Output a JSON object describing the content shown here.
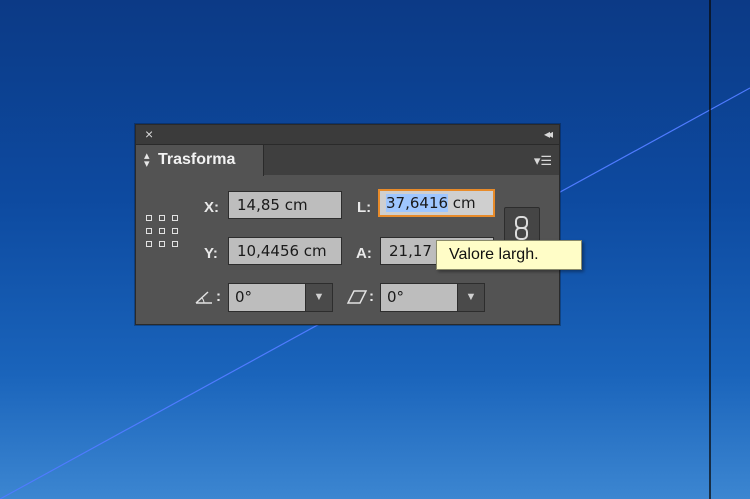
{
  "panel": {
    "close_glyph": "×",
    "collapse_glyph": "◂◂",
    "tab_title": "Trasforma",
    "menu_icon": "panel-menu-icon",
    "fields": {
      "x_label": "X:",
      "x_value": "14,85 cm",
      "y_label": "Y:",
      "y_value": "10,4456 cm",
      "l_label": "L:",
      "l_value_selected": "37,6416",
      "l_value_unit": " cm",
      "a_label": "A:",
      "a_value": "21,17"
    },
    "rotate_value": "0°",
    "shear_value": "0°",
    "rotate_suffix": ":",
    "shear_suffix": ":"
  },
  "tooltip": {
    "text": "Valore largh."
  },
  "colors": {
    "focus_border": "#e88b2a",
    "guide_line": "#4f7bff",
    "panel_bg": "#535353"
  }
}
